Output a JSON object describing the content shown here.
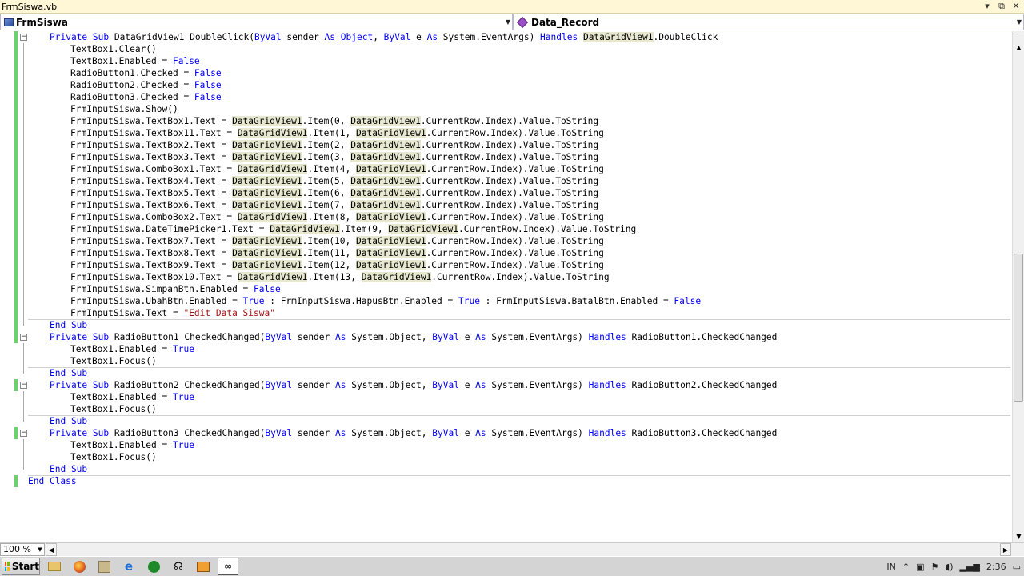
{
  "window": {
    "title": "FrmSiswa.vb",
    "controls": [
      "▾",
      "⧉",
      "✕"
    ]
  },
  "nav": {
    "class_dropdown": "FrmSiswa",
    "member_dropdown": "Data_Record"
  },
  "code_lines": [
    [
      {
        "t": "Private Sub",
        "k": 1
      },
      {
        "t": " DataGridView1_DoubleClick("
      },
      {
        "t": "ByVal",
        "k": 1
      },
      {
        "t": " sender "
      },
      {
        "t": "As",
        "k": 1
      },
      {
        "t": " "
      },
      {
        "t": "Object",
        "k": 1
      },
      {
        "t": ", "
      },
      {
        "t": "ByVal",
        "k": 1
      },
      {
        "t": " e "
      },
      {
        "t": "As",
        "k": 1
      },
      {
        "t": " System.EventArgs) "
      },
      {
        "t": "Handles",
        "k": 1
      },
      {
        "t": " "
      },
      {
        "t": "DataGridView1",
        "h": 1
      },
      {
        "t": ".DoubleClick"
      }
    ],
    [
      {
        "t": "TextBox1.Clear()"
      }
    ],
    [
      {
        "t": "TextBox1.Enabled = "
      },
      {
        "t": "False",
        "k": 1
      }
    ],
    [
      {
        "t": "RadioButton1.Checked = "
      },
      {
        "t": "False",
        "k": 1
      }
    ],
    [
      {
        "t": "RadioButton2.Checked = "
      },
      {
        "t": "False",
        "k": 1
      }
    ],
    [
      {
        "t": "RadioButton3.Checked = "
      },
      {
        "t": "False",
        "k": 1
      }
    ],
    [
      {
        "t": "FrmInputSiswa.Show()"
      }
    ],
    [
      {
        "t": "FrmInputSiswa.TextBox1.Text = "
      },
      {
        "t": "DataGridView1",
        "h": 1
      },
      {
        "t": ".Item(0, "
      },
      {
        "t": "DataGridView1",
        "h": 1
      },
      {
        "t": ".CurrentRow.Index).Value.ToString"
      }
    ],
    [
      {
        "t": "FrmInputSiswa.TextBox11.Text = "
      },
      {
        "t": "DataGridView1",
        "h": 1
      },
      {
        "t": ".Item(1, "
      },
      {
        "t": "DataGridView1",
        "h": 1
      },
      {
        "t": ".CurrentRow.Index).Value.ToString"
      }
    ],
    [
      {
        "t": "FrmInputSiswa.TextBox2.Text = "
      },
      {
        "t": "DataGridView1",
        "h": 1
      },
      {
        "t": ".Item(2, "
      },
      {
        "t": "DataGridView1",
        "h": 1
      },
      {
        "t": ".CurrentRow.Index).Value.ToString"
      }
    ],
    [
      {
        "t": "FrmInputSiswa.TextBox3.Text = "
      },
      {
        "t": "DataGridView1",
        "h": 1
      },
      {
        "t": ".Item(3, "
      },
      {
        "t": "DataGridView1",
        "h": 1
      },
      {
        "t": ".CurrentRow.Index).Value.ToString"
      }
    ],
    [
      {
        "t": "FrmInputSiswa.ComboBox1.Text = "
      },
      {
        "t": "DataGridView1",
        "h": 1
      },
      {
        "t": ".Item(4, "
      },
      {
        "t": "DataGridView1",
        "h": 1
      },
      {
        "t": ".CurrentRow.Index).Value.ToString"
      }
    ],
    [
      {
        "t": "FrmInputSiswa.TextBox4.Text = "
      },
      {
        "t": "DataGridView1",
        "h": 1
      },
      {
        "t": ".Item(5, "
      },
      {
        "t": "DataGridView1",
        "h": 1
      },
      {
        "t": ".CurrentRow.Index).Value.ToString"
      }
    ],
    [
      {
        "t": "FrmInputSiswa.TextBox5.Text = "
      },
      {
        "t": "DataGridView1",
        "h": 1
      },
      {
        "t": ".Item(6, "
      },
      {
        "t": "DataGridView1",
        "h": 1
      },
      {
        "t": ".CurrentRow.Index).Value.ToString"
      }
    ],
    [
      {
        "t": "FrmInputSiswa.TextBox6.Text = "
      },
      {
        "t": "DataGridView1",
        "h": 1
      },
      {
        "t": ".Item(7, "
      },
      {
        "t": "DataGridView1",
        "h": 1
      },
      {
        "t": ".CurrentRow.Index).Value.ToString"
      }
    ],
    [
      {
        "t": "FrmInputSiswa.ComboBox2.Text = "
      },
      {
        "t": "DataGridView1",
        "h": 1
      },
      {
        "t": ".Item(8, "
      },
      {
        "t": "DataGridView1",
        "h": 1
      },
      {
        "t": ".CurrentRow.Index).Value.ToString"
      }
    ],
    [
      {
        "t": "FrmInputSiswa.DateTimePicker1.Text = "
      },
      {
        "t": "DataGridView1",
        "h": 1
      },
      {
        "t": ".Item(9, "
      },
      {
        "t": "DataGridView1",
        "h": 1
      },
      {
        "t": ".CurrentRow.Index).Value.ToString"
      }
    ],
    [
      {
        "t": "FrmInputSiswa.TextBox7.Text = "
      },
      {
        "t": "DataGridView1",
        "h": 1
      },
      {
        "t": ".Item(10, "
      },
      {
        "t": "DataGridView1",
        "h": 1
      },
      {
        "t": ".CurrentRow.Index).Value.ToString"
      }
    ],
    [
      {
        "t": "FrmInputSiswa.TextBox8.Text = "
      },
      {
        "t": "DataGridView1",
        "h": 1
      },
      {
        "t": ".Item(11, "
      },
      {
        "t": "DataGridView1",
        "h": 1
      },
      {
        "t": ".CurrentRow.Index).Value.ToString"
      }
    ],
    [
      {
        "t": "FrmInputSiswa.TextBox9.Text = "
      },
      {
        "t": "DataGridView1",
        "h": 1
      },
      {
        "t": ".Item(12, "
      },
      {
        "t": "DataGridView1",
        "h": 1
      },
      {
        "t": ".CurrentRow.Index).Value.ToString"
      }
    ],
    [
      {
        "t": "FrmInputSiswa.TextBox10.Text = "
      },
      {
        "t": "DataGridView1",
        "h": 1
      },
      {
        "t": ".Item(13, "
      },
      {
        "t": "DataGridView1",
        "h": 1
      },
      {
        "t": ".CurrentRow.Index).Value.ToString"
      }
    ],
    [
      {
        "t": "FrmInputSiswa.SimpanBtn.Enabled = "
      },
      {
        "t": "False",
        "k": 1
      }
    ],
    [
      {
        "t": "FrmInputSiswa.UbahBtn.Enabled = "
      },
      {
        "t": "True",
        "k": 1
      },
      {
        "t": " : FrmInputSiswa.HapusBtn.Enabled = "
      },
      {
        "t": "True",
        "k": 1
      },
      {
        "t": " : FrmInputSiswa.BatalBtn.Enabled = "
      },
      {
        "t": "False",
        "k": 1
      }
    ],
    [
      {
        "t": "FrmInputSiswa.Text = "
      },
      {
        "t": "\"Edit Data Siswa\"",
        "s": 1
      }
    ],
    [
      {
        "t": "End Sub",
        "k": 1
      }
    ],
    [
      {
        "t": "Private Sub",
        "k": 1
      },
      {
        "t": " RadioButton1_CheckedChanged("
      },
      {
        "t": "ByVal",
        "k": 1
      },
      {
        "t": " sender "
      },
      {
        "t": "As",
        "k": 1
      },
      {
        "t": " System.Object, "
      },
      {
        "t": "ByVal",
        "k": 1
      },
      {
        "t": " e "
      },
      {
        "t": "As",
        "k": 1
      },
      {
        "t": " System.EventArgs) "
      },
      {
        "t": "Handles",
        "k": 1
      },
      {
        "t": " RadioButton1.CheckedChanged"
      }
    ],
    [
      {
        "t": "TextBox1.Enabled = "
      },
      {
        "t": "True",
        "k": 1
      }
    ],
    [
      {
        "t": "TextBox1.Focus()"
      }
    ],
    [
      {
        "t": "End Sub",
        "k": 1
      }
    ],
    [
      {
        "t": "Private Sub",
        "k": 1
      },
      {
        "t": " RadioButton2_CheckedChanged("
      },
      {
        "t": "ByVal",
        "k": 1
      },
      {
        "t": " sender "
      },
      {
        "t": "As",
        "k": 1
      },
      {
        "t": " System.Object, "
      },
      {
        "t": "ByVal",
        "k": 1
      },
      {
        "t": " e "
      },
      {
        "t": "As",
        "k": 1
      },
      {
        "t": " System.EventArgs) "
      },
      {
        "t": "Handles",
        "k": 1
      },
      {
        "t": " RadioButton2.CheckedChanged"
      }
    ],
    [
      {
        "t": "TextBox1.Enabled = "
      },
      {
        "t": "True",
        "k": 1
      }
    ],
    [
      {
        "t": "TextBox1.Focus()"
      }
    ],
    [
      {
        "t": "End Sub",
        "k": 1
      }
    ],
    [
      {
        "t": "Private Sub",
        "k": 1
      },
      {
        "t": " RadioButton3_CheckedChanged("
      },
      {
        "t": "ByVal",
        "k": 1
      },
      {
        "t": " sender "
      },
      {
        "t": "As",
        "k": 1
      },
      {
        "t": " System.Object, "
      },
      {
        "t": "ByVal",
        "k": 1
      },
      {
        "t": " e "
      },
      {
        "t": "As",
        "k": 1
      },
      {
        "t": " System.EventArgs) "
      },
      {
        "t": "Handles",
        "k": 1
      },
      {
        "t": " RadioButton3.CheckedChanged"
      }
    ],
    [
      {
        "t": "TextBox1.Enabled = "
      },
      {
        "t": "True",
        "k": 1
      }
    ],
    [
      {
        "t": "TextBox1.Focus()"
      }
    ],
    [
      {
        "t": "End Sub",
        "k": 1
      }
    ],
    [
      {
        "t": "End Class",
        "k": 1
      }
    ]
  ],
  "line_indent": [
    1,
    2,
    2,
    2,
    2,
    2,
    2,
    2,
    2,
    2,
    2,
    2,
    2,
    2,
    2,
    2,
    2,
    2,
    2,
    2,
    2,
    2,
    2,
    2,
    1,
    1,
    2,
    2,
    1,
    1,
    2,
    2,
    1,
    1,
    2,
    2,
    1,
    0
  ],
  "line_markers": [
    "box",
    "",
    "",
    "",
    "",
    "",
    "",
    "",
    "",
    "",
    "",
    "",
    "",
    "",
    "",
    "",
    "",
    "",
    "",
    "",
    "",
    "",
    "",
    "",
    "end",
    "box",
    "",
    "",
    "end",
    "box",
    "",
    "",
    "end",
    "box",
    "",
    "",
    "end",
    ""
  ],
  "line_changed": [
    1,
    1,
    1,
    1,
    1,
    1,
    1,
    1,
    1,
    1,
    1,
    1,
    1,
    1,
    1,
    1,
    1,
    1,
    1,
    1,
    1,
    1,
    1,
    1,
    1,
    1,
    0,
    0,
    0,
    1,
    0,
    0,
    0,
    1,
    0,
    0,
    0,
    1
  ],
  "separators_after": [
    24,
    28,
    32,
    37
  ],
  "zoom": {
    "value": "100 %"
  },
  "taskbar": {
    "start_label": "Start",
    "apps": [
      "file-explorer-icon",
      "firefox-icon",
      "tools-icon",
      "internet-explorer-icon",
      "media-icon",
      "network-icon",
      "video-icon",
      "visual-studio-icon"
    ],
    "tray": {
      "language": "IN",
      "time": "2:36"
    }
  },
  "colors": {
    "keyword": "#0000ff",
    "string": "#a31515",
    "changed": "#6cd36c",
    "highlight": "#e8e8d0",
    "titlebar": "#fff7d6"
  }
}
